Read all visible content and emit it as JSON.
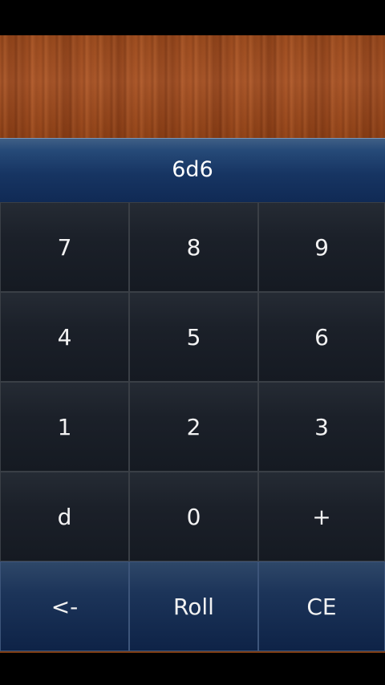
{
  "display": {
    "expression": "6d6"
  },
  "keypad": {
    "keys": [
      {
        "label": "7",
        "name": "key-7"
      },
      {
        "label": "8",
        "name": "key-8"
      },
      {
        "label": "9",
        "name": "key-9"
      },
      {
        "label": "4",
        "name": "key-4"
      },
      {
        "label": "5",
        "name": "key-5"
      },
      {
        "label": "6",
        "name": "key-6"
      },
      {
        "label": "1",
        "name": "key-1"
      },
      {
        "label": "2",
        "name": "key-2"
      },
      {
        "label": "3",
        "name": "key-3"
      },
      {
        "label": "d",
        "name": "key-d"
      },
      {
        "label": "0",
        "name": "key-0"
      },
      {
        "label": "+",
        "name": "key-plus"
      }
    ],
    "actions": [
      {
        "label": "<-",
        "name": "backspace-button"
      },
      {
        "label": "Roll",
        "name": "roll-button"
      },
      {
        "label": "CE",
        "name": "clear-entry-button"
      }
    ]
  },
  "colors": {
    "wood": "#9a4b1e",
    "display_bg": "#173563",
    "key_bg": "#1b2029",
    "action_bg": "#1c3459"
  }
}
